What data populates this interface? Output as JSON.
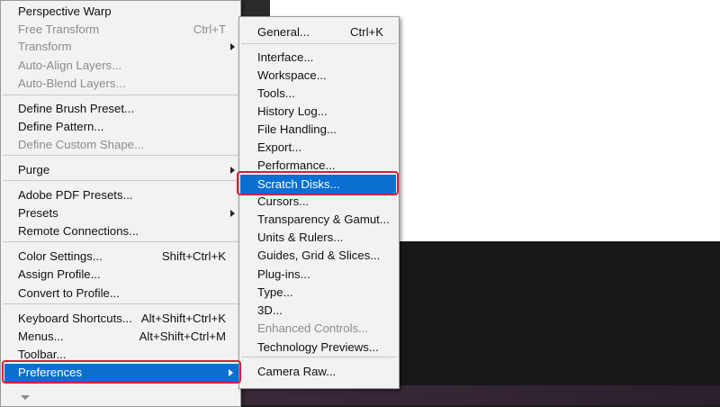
{
  "main_menu": {
    "items": [
      {
        "label": "Perspective Warp",
        "shortcut": "",
        "disabled": false,
        "submenu": false
      },
      {
        "label": "Free Transform",
        "shortcut": "Ctrl+T",
        "disabled": true,
        "submenu": false
      },
      {
        "label": "Transform",
        "shortcut": "",
        "disabled": true,
        "submenu": true
      },
      {
        "label": "Auto-Align Layers...",
        "shortcut": "",
        "disabled": true,
        "submenu": false
      },
      {
        "label": "Auto-Blend Layers...",
        "shortcut": "",
        "disabled": true,
        "submenu": false
      },
      {
        "label": "Define Brush Preset...",
        "shortcut": "",
        "disabled": false,
        "submenu": false
      },
      {
        "label": "Define Pattern...",
        "shortcut": "",
        "disabled": false,
        "submenu": false
      },
      {
        "label": "Define Custom Shape...",
        "shortcut": "",
        "disabled": true,
        "submenu": false
      },
      {
        "label": "Purge",
        "shortcut": "",
        "disabled": false,
        "submenu": true
      },
      {
        "label": "Adobe PDF Presets...",
        "shortcut": "",
        "disabled": false,
        "submenu": false
      },
      {
        "label": "Presets",
        "shortcut": "",
        "disabled": false,
        "submenu": true
      },
      {
        "label": "Remote Connections...",
        "shortcut": "",
        "disabled": false,
        "submenu": false
      },
      {
        "label": "Color Settings...",
        "shortcut": "Shift+Ctrl+K",
        "disabled": false,
        "submenu": false
      },
      {
        "label": "Assign Profile...",
        "shortcut": "",
        "disabled": false,
        "submenu": false
      },
      {
        "label": "Convert to Profile...",
        "shortcut": "",
        "disabled": false,
        "submenu": false
      },
      {
        "label": "Keyboard Shortcuts...",
        "shortcut": "Alt+Shift+Ctrl+K",
        "disabled": false,
        "submenu": false
      },
      {
        "label": "Menus...",
        "shortcut": "Alt+Shift+Ctrl+M",
        "disabled": false,
        "submenu": false
      },
      {
        "label": "Toolbar...",
        "shortcut": "",
        "disabled": false,
        "submenu": false
      },
      {
        "label": "Preferences",
        "shortcut": "",
        "disabled": false,
        "submenu": true,
        "highlighted": true
      }
    ]
  },
  "preferences_submenu": {
    "items": [
      {
        "label": "General...",
        "shortcut": "Ctrl+K",
        "disabled": false
      },
      {
        "label": "Interface...",
        "shortcut": "",
        "disabled": false
      },
      {
        "label": "Workspace...",
        "shortcut": "",
        "disabled": false
      },
      {
        "label": "Tools...",
        "shortcut": "",
        "disabled": false
      },
      {
        "label": "History Log...",
        "shortcut": "",
        "disabled": false
      },
      {
        "label": "File Handling...",
        "shortcut": "",
        "disabled": false
      },
      {
        "label": "Export...",
        "shortcut": "",
        "disabled": false
      },
      {
        "label": "Performance...",
        "shortcut": "",
        "disabled": false
      },
      {
        "label": "Scratch Disks...",
        "shortcut": "",
        "disabled": false,
        "highlighted": true
      },
      {
        "label": "Cursors...",
        "shortcut": "",
        "disabled": false
      },
      {
        "label": "Transparency & Gamut...",
        "shortcut": "",
        "disabled": false
      },
      {
        "label": "Units & Rulers...",
        "shortcut": "",
        "disabled": false
      },
      {
        "label": "Guides, Grid & Slices...",
        "shortcut": "",
        "disabled": false
      },
      {
        "label": "Plug-ins...",
        "shortcut": "",
        "disabled": false
      },
      {
        "label": "Type...",
        "shortcut": "",
        "disabled": false
      },
      {
        "label": "3D...",
        "shortcut": "",
        "disabled": false
      },
      {
        "label": "Enhanced Controls...",
        "shortcut": "",
        "disabled": true
      },
      {
        "label": "Technology Previews...",
        "shortcut": "",
        "disabled": false
      },
      {
        "label": "Camera Raw...",
        "shortcut": "",
        "disabled": false
      }
    ]
  },
  "colors": {
    "highlight": "#0a6fd1",
    "callout_border": "#d1213b"
  }
}
